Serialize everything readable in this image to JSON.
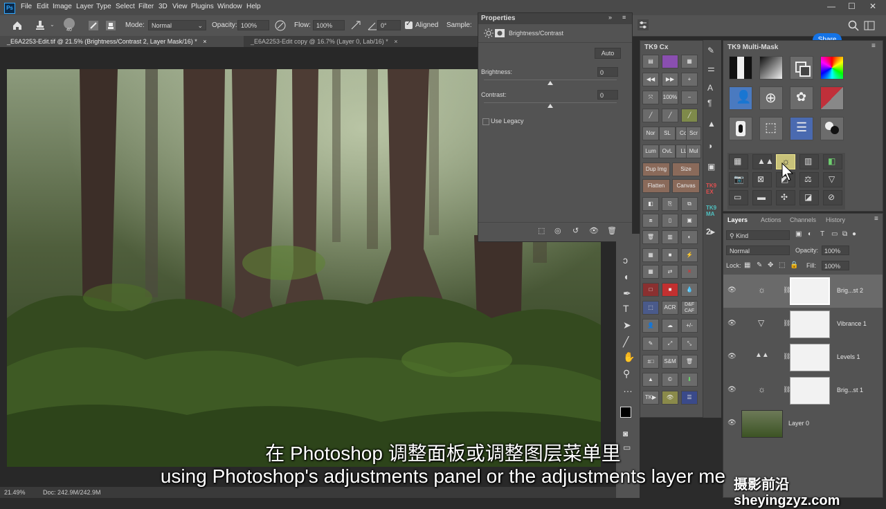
{
  "menubar": {
    "app_icon": "Ps",
    "items": [
      "File",
      "Edit",
      "Image",
      "Layer",
      "Type",
      "Select",
      "Filter",
      "3D",
      "View",
      "Plugins",
      "Window",
      "Help"
    ]
  },
  "options": {
    "brush_size": "40",
    "mode_label": "Mode:",
    "mode_value": "Normal",
    "opacity_label": "Opacity:",
    "opacity_value": "100%",
    "flow_label": "Flow:",
    "flow_value": "100%",
    "angle_value": "0°",
    "aligned_label": "Aligned",
    "sample_label": "Sample:",
    "share_label": "Share"
  },
  "tabs": [
    {
      "label": "_E6A2253-Edit.tif @ 21.5% (Brightness/Contrast 2, Layer Mask/16) *"
    },
    {
      "label": "_E6A2253-Edit copy @ 16.7% (Layer 0, Lab/16) *"
    }
  ],
  "properties": {
    "title": "Properties",
    "subtitle": "Brightness/Contrast",
    "auto_label": "Auto",
    "brightness_label": "Brightness:",
    "brightness_value": "0",
    "brightness_level": 0.5,
    "contrast_label": "Contrast:",
    "contrast_value": "0",
    "contrast_level": 0.5,
    "legacy_label": "Use Legacy"
  },
  "tk9cx": {
    "title": "TK9 Cx",
    "row_text": [
      "Nor",
      "SL",
      "Col",
      "Scr"
    ],
    "row_text2": [
      "Lum",
      "OvL",
      "LL",
      "Mul"
    ],
    "dup_img": "Dup Img",
    "size": "Size",
    "flatten": "Flatten",
    "canvas": "Canvas",
    "zoom_pct": "100%",
    "acr": "ACR",
    "dfcaf": "D&F CAF",
    "plusminus": "+/-",
    "pmbox": "±□",
    "sm": "S&M",
    "tk": "TK▶"
  },
  "sidestrip": {
    "ex": "TK9 EX",
    "ma": "TK9 MA"
  },
  "multimask": {
    "title": "TK9 Multi-Mask"
  },
  "layers": {
    "tabs": [
      "Layers",
      "Actions",
      "Channels",
      "History"
    ],
    "kind_label": "Kind",
    "blend_mode": "Normal",
    "opacity_label": "Opacity:",
    "opacity_value": "100%",
    "lock_label": "Lock:",
    "fill_label": "Fill:",
    "fill_value": "100%",
    "rows": [
      {
        "name": "Brig...st 2",
        "icon": "brightness-icon"
      },
      {
        "name": "Vibrance 1",
        "icon": "vibrance-icon"
      },
      {
        "name": "Levels 1",
        "icon": "levels-icon"
      },
      {
        "name": "Brig...st 1",
        "icon": "brightness-icon"
      },
      {
        "name": "Layer 0",
        "icon": "image-thumb"
      }
    ]
  },
  "status": {
    "zoom": "21.49%",
    "doc": "Doc: 242.9M/242.9M"
  },
  "subtitles": {
    "cn": "在 Photoshop 调整面板或调整图层菜单里",
    "en": "using Photoshop's adjustments panel or the adjustments layer me"
  },
  "watermark": "摄影前沿 sheyingzyz.com",
  "colors": {
    "accent": "#1473e6",
    "panel": "#535353",
    "highlight_button": "#c8c27a"
  }
}
